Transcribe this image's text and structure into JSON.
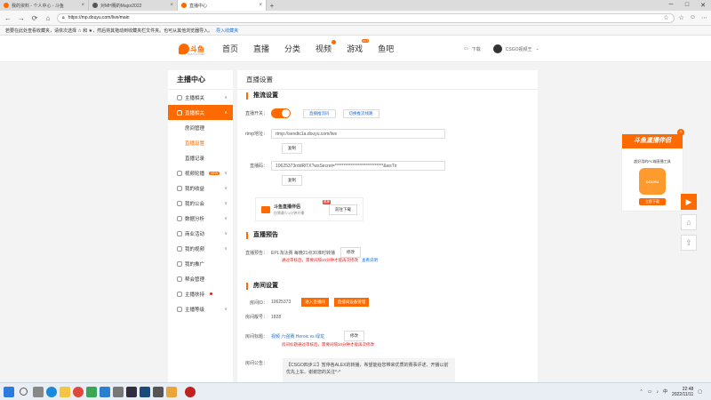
{
  "browser": {
    "tabs": [
      {
        "title": "我的资料 - 个人中心 - 斗鱼",
        "color": "#ff6a00",
        "active": false
      },
      {
        "title": "对MH赛的Major2022",
        "color": "#555555",
        "active": false
      },
      {
        "title": "直播中心",
        "color": "#ff6a00",
        "active": true
      }
    ],
    "url": "https://mp.douyu.com/live/main",
    "bookmark_hint": "若要在此处查看收藏夹，请依次选择 ☆ 和 ★，然后将其拖动到收藏夹栏文件夹。也可从其他浏览器导入。",
    "bookmark_link": "导入收藏夹"
  },
  "header": {
    "logo_text": "斗鱼",
    "logo_sub": "DOUYU.COM",
    "nav": [
      {
        "label": "首页"
      },
      {
        "label": "直播"
      },
      {
        "label": "分类"
      },
      {
        "label": "视频",
        "dot": true
      },
      {
        "label": "游戏",
        "badge": "HOT"
      },
      {
        "label": "鱼吧"
      }
    ],
    "download": "下载",
    "username": "CSGO视频王"
  },
  "sidebar": {
    "title": "主播中心",
    "items": [
      {
        "label": "主播相关",
        "chev": "∧",
        "active": false
      },
      {
        "label": "直播相关",
        "chev": "∧",
        "active": true
      },
      {
        "sub": "房间管理"
      },
      {
        "sub": "直播设置",
        "current": true
      },
      {
        "sub": "直播记录"
      },
      {
        "label": "视频轮播",
        "chev": "∨",
        "tag": "NEW"
      },
      {
        "label": "我的收益",
        "chev": "∨"
      },
      {
        "label": "我的公会",
        "chev": "∨"
      },
      {
        "label": "数据分析",
        "chev": "∨"
      },
      {
        "label": "商业活动",
        "chev": "∨"
      },
      {
        "label": "我的视频",
        "chev": "∨"
      },
      {
        "label": "我的推广",
        "chev": ""
      },
      {
        "label": "帮会管理",
        "chev": ""
      },
      {
        "label": "主播扶持",
        "chev": "",
        "reddot": true
      },
      {
        "label": "主播等级",
        "chev": "∨"
      }
    ]
  },
  "main": {
    "title": "直播设置",
    "push": {
      "heading": "推流设置",
      "switch_label": "直播开关：",
      "btn_push_code": "直播推流码",
      "btn_switch_line": "切换推流线路",
      "rtmp_label": "rtmp地址：",
      "rtmp_value": "rtmp://sendtc1a.douyu.com/live",
      "copy": "复制",
      "code_label": "直播码：",
      "code_value": "10625373rddRlTX?wsSecret=****************************&wsTir",
      "copy2": "复制"
    },
    "promo": {
      "title": "斗鱼直播伴侣",
      "sub": "仅需最少1分钟开播",
      "hot": "推荐",
      "btn": "前往下载"
    },
    "forecast": {
      "heading": "直播预告",
      "label": "直播预告：",
      "value": "EPL淘汰赛 每晚21点30准时转播",
      "edit": "修改",
      "warn": "通过审核后，需要间隔10分钟才能再次修改",
      "link": "查看说明"
    },
    "room": {
      "heading": "房间设置",
      "id_label": "房间ID：",
      "id_value": "10625373",
      "btn_enter": "进入直播间",
      "btn_mgr": "直播间设备管理",
      "num_label": "房间靓号：",
      "num_value": "1828",
      "title_label": "房间标题：",
      "title_value": "视频 六强赛 Heroic vs 绿龙",
      "title_edit": "修改",
      "title_warn": "房间标题通过审核后，需要间隔10分钟才能再次修改",
      "notice_label": "房间公告：",
      "notice_value": "【CSGO四步三】暂停各ALEX的转播，希望能给您带来优质的赛事评述、开播以前优先上车、谢谢您的关注^-^"
    }
  },
  "floating": {
    "head": "斗鱼直播伴侣",
    "sub": "超好用的PC端直播工具",
    "img_text": "DOUYU",
    "btn": "立即下载"
  },
  "taskbar": {
    "time": "22:48",
    "date": "2022/11/11"
  }
}
